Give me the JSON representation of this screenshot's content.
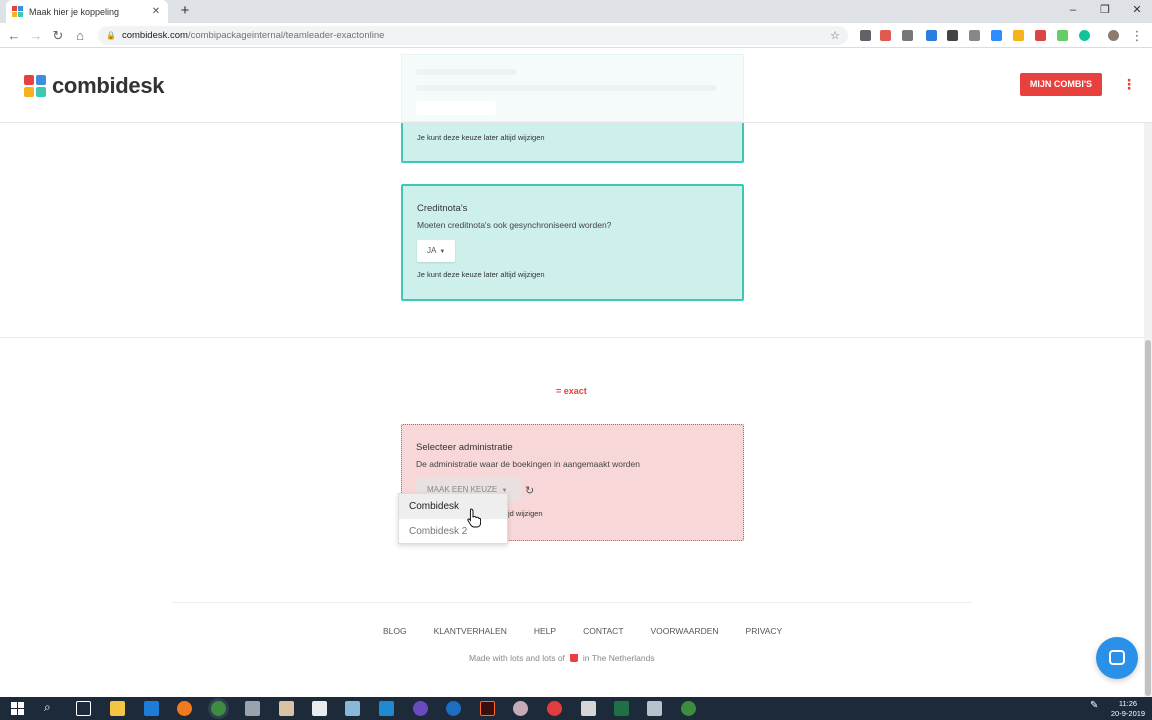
{
  "browser": {
    "tab_title": "Maak hier je koppeling",
    "tab_close": "✕",
    "new_tab": "+",
    "url_host": "combidesk.com",
    "url_path": "/combipackageinternal/teamleader-exactonline",
    "window_controls": [
      "–",
      "❐",
      "✕"
    ]
  },
  "header": {
    "logo_text": "combidesk",
    "mijn_combis": "MIJN COMBI'S",
    "kebab": "⋮"
  },
  "cards": [
    {
      "hint": "Je kunt deze keuze later altijd wijzigen"
    },
    {
      "title": "Creditnota's",
      "desc": "Moeten creditnota's ook gesynchroniseerd worden?",
      "value": "JA",
      "hint": "Je kunt deze keuze later altijd wijzigen"
    },
    {
      "title": "Selecteer administratie",
      "desc": "De administratie waar de boekingen in aangemaakt worden",
      "button": "MAAK EEN KEUZE",
      "hint_tail": "jd wijzigen"
    }
  ],
  "exact_logo": "= exact",
  "dropdown": {
    "options": [
      "Combidesk",
      "Combidesk 2"
    ],
    "highlighted": "Combidesk"
  },
  "footer": {
    "links": [
      "BLOG",
      "KLANTVERHALEN",
      "HELP",
      "CONTACT",
      "VOORWAARDEN",
      "PRIVACY"
    ],
    "made_pre": "Made with lots and lots of",
    "made_post": "in The Netherlands"
  },
  "taskbar": {
    "time": "11:26",
    "date": "20-9-2019"
  },
  "colors": {
    "accent_red": "#e8403c",
    "teal_border": "#3cc8b4",
    "teal_bg": "#cdf0ec",
    "pink_bg": "#f8d7d8"
  }
}
